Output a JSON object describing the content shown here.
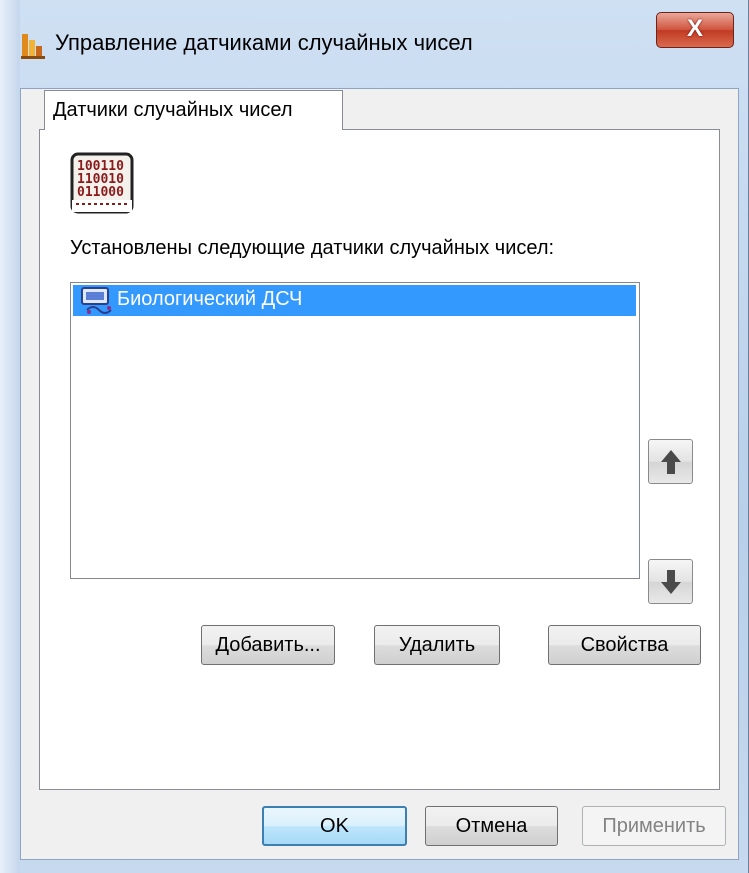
{
  "window": {
    "title": "Управление датчиками случайных чисел",
    "close_label": "X"
  },
  "tabs": [
    {
      "label": "Датчики случайных чисел",
      "selected": true
    }
  ],
  "panel": {
    "icon": "rng-binary-icon",
    "installed_label": "Установлены следующие датчики случайных чисел:",
    "list": {
      "items": [
        {
          "label": "Биологический ДСЧ",
          "selected": true,
          "icon": "bio-rng-icon"
        }
      ]
    },
    "move_up_icon": "arrow-up-icon",
    "move_down_icon": "arrow-down-icon",
    "buttons": {
      "add": "Добавить...",
      "remove": "Удалить",
      "properties": "Свойства"
    }
  },
  "footer": {
    "ok": "OK",
    "cancel": "Отмена",
    "apply": "Применить",
    "apply_disabled": true
  },
  "colors": {
    "selection": "#3399ff",
    "close_button": "#c03a22"
  }
}
